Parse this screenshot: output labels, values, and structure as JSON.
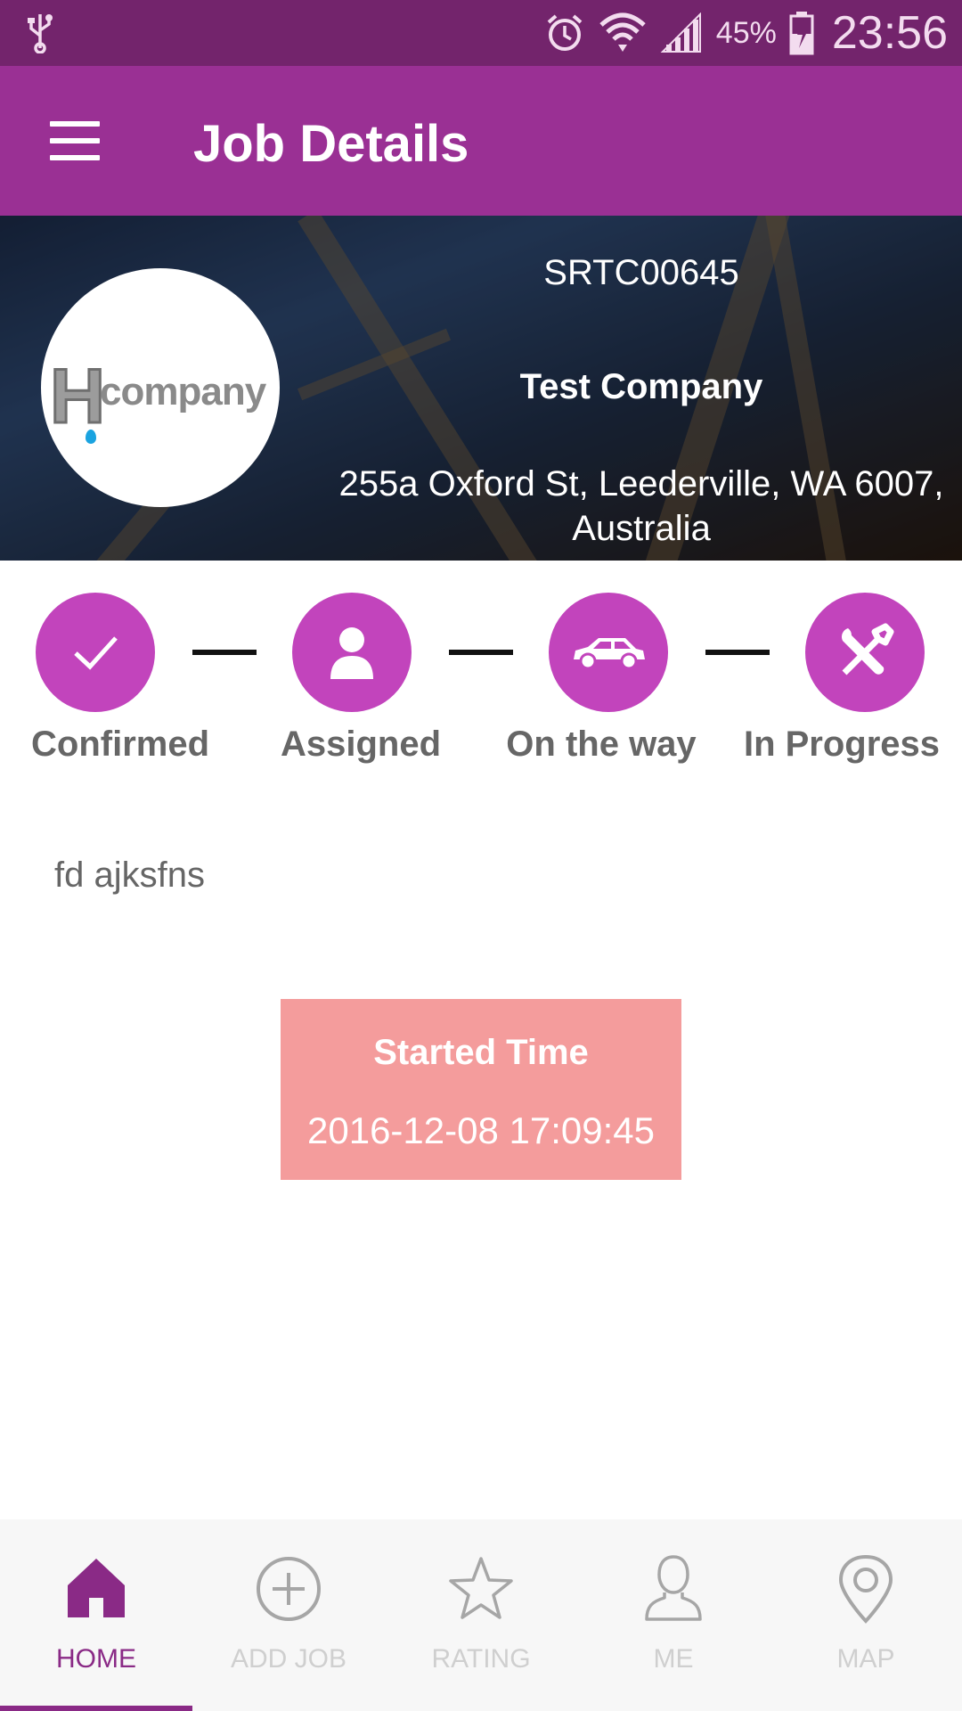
{
  "status_bar": {
    "battery_percent": "45%",
    "time": "23:56",
    "icons": [
      "usb-icon",
      "alarm-icon",
      "wifi-icon",
      "cell-signal-icon",
      "battery-charging-icon"
    ]
  },
  "app_bar": {
    "title": "Job Details",
    "menu_icon": "hamburger-menu-icon",
    "color": "#9a3094"
  },
  "job": {
    "code": "SRTC00645",
    "company": "Test Company",
    "address": "255a Oxford St, Leederville, WA 6007, Australia",
    "logo": {
      "letter": "H",
      "word": "company"
    }
  },
  "steps": [
    {
      "label": "Confirmed",
      "icon": "checkmark-icon"
    },
    {
      "label": "Assigned",
      "icon": "person-icon"
    },
    {
      "label": "On the way",
      "icon": "car-icon"
    },
    {
      "label": "In Progress",
      "icon": "tools-icon"
    }
  ],
  "description": "fd ajksfns",
  "started": {
    "label": "Started Time",
    "value": "2016-12-08 17:09:45"
  },
  "bottom_nav": {
    "active": "HOME",
    "items": [
      {
        "label": "HOME",
        "icon": "home-icon"
      },
      {
        "label": "ADD JOB",
        "icon": "add-circle-icon"
      },
      {
        "label": "RATING",
        "icon": "star-icon"
      },
      {
        "label": "ME",
        "icon": "person-outline-icon"
      },
      {
        "label": "MAP",
        "icon": "map-pin-icon"
      }
    ]
  },
  "colors": {
    "primary": "#9a3094",
    "primary_dark": "#73246c",
    "step": "#c244bc",
    "card": "#f49c9c",
    "nav_active": "#8a2a86"
  }
}
